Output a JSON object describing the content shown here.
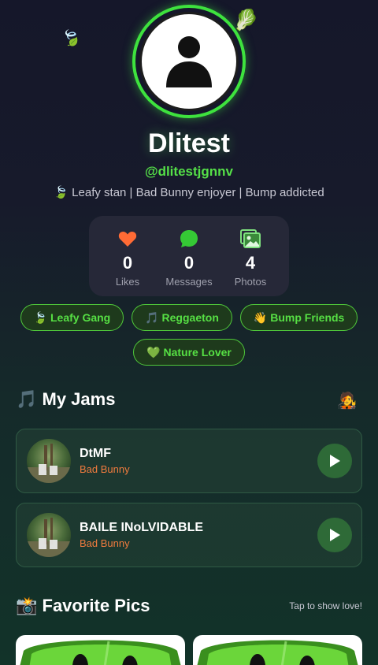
{
  "profile": {
    "name": "Dlitest",
    "handle": "@dlitestjgnnv",
    "bio": "🍃 Leafy stan | Bad Bunny enjoyer | Bump addicted"
  },
  "stats": [
    {
      "value": "0",
      "label": "Likes",
      "icon": "heart-icon",
      "color": "#ff6b35"
    },
    {
      "value": "0",
      "label": "Messages",
      "icon": "chat-bubble-icon",
      "color": "#35c935"
    },
    {
      "value": "4",
      "label": "Photos",
      "icon": "photos-icon",
      "color": "#7ee07e"
    }
  ],
  "tags": [
    "🍃 Leafy Gang",
    "🎵 Reggaeton",
    "👋 Bump Friends",
    "💚 Nature Lover"
  ],
  "jams": {
    "title": "🎵 My Jams",
    "songs": [
      {
        "title": "DtMF",
        "artist": "Bad Bunny"
      },
      {
        "title": "BAILE INoLVIDABLE",
        "artist": "Bad Bunny"
      }
    ]
  },
  "pics": {
    "title": "📸 Favorite Pics",
    "hint": "Tap to show love!"
  },
  "colors": {
    "accent_green": "#3ee23e",
    "artist_orange": "#f07b3e"
  }
}
